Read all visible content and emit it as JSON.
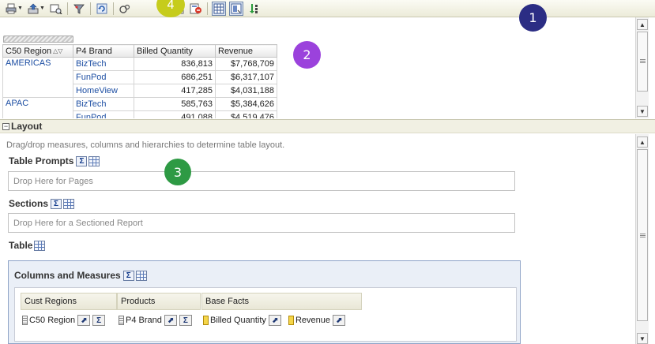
{
  "badges": [
    "1",
    "2",
    "3",
    "4"
  ],
  "colors": {
    "badge1": "#2b2d84",
    "badge2": "#9b42dc",
    "badge3": "#2e9a44",
    "badge4": "#c6cc1c"
  },
  "toolbar": {
    "icons": [
      "print-icon",
      "export-icon",
      "view-icon",
      "filter-icon",
      "refresh-icon",
      "settings-icon",
      "format-icon",
      "exclude-icon",
      "table-view-icon",
      "layout-icon",
      "sort-icon"
    ]
  },
  "preview": {
    "columns": [
      "C50 Region",
      "P4 Brand",
      "Billed Quantity",
      "Revenue"
    ],
    "rows": [
      {
        "region": "AMERICAS",
        "brand": "BizTech",
        "qty": "836,813",
        "rev": "$7,768,709"
      },
      {
        "region": "",
        "brand": "FunPod",
        "qty": "686,251",
        "rev": "$6,317,107"
      },
      {
        "region": "",
        "brand": "HomeView",
        "qty": "417,285",
        "rev": "$4,031,188"
      },
      {
        "region": "APAC",
        "brand": "BizTech",
        "qty": "585,763",
        "rev": "$5,384,626"
      },
      {
        "region": "",
        "brand": "FunPod",
        "qty": "491,088",
        "rev": "$4,519,476"
      }
    ]
  },
  "layout": {
    "title": "Layout",
    "hint": "Drag/drop measures, columns and hierarchies to determine table layout.",
    "table_prompts": "Table Prompts",
    "table_prompts_drop": "Drop Here for Pages",
    "sections": "Sections",
    "sections_drop": "Drop Here for a Sectioned Report",
    "table": "Table",
    "columns_measures": "Columns and Measures",
    "groups": [
      {
        "header": "Cust Regions",
        "item": "C50 Region",
        "kind": "dim"
      },
      {
        "header": "Products",
        "item": "P4 Brand",
        "kind": "dim"
      },
      {
        "header": "Base Facts",
        "item": "Billed Quantity",
        "kind": "fact"
      },
      {
        "header": "",
        "item": "Revenue",
        "kind": "fact"
      }
    ]
  }
}
